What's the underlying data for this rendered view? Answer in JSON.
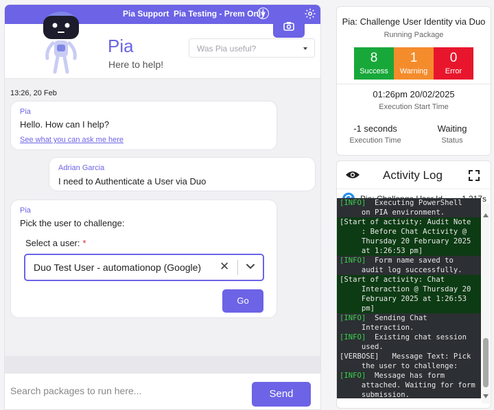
{
  "topbar": {
    "support_label": "Pia Support",
    "workspace_label": "Pia Testing - Prem Only",
    "info_glyph": "i"
  },
  "header": {
    "name": "Pia",
    "subtitle": "Here to help!",
    "feedback_placeholder": "Was Pia useful?"
  },
  "chat": {
    "timestamp": "13:26, 20 Feb",
    "messages": [
      {
        "sender": "Pia",
        "text": "Hello. How can I help?",
        "link": "See what you can ask me here"
      },
      {
        "sender": "Adrian Garcia",
        "text": "I need to Authenticate a User via Duo"
      },
      {
        "sender": "Pia",
        "text": "Pick the user to challenge:",
        "field_label": "Select a user:",
        "required_mark": "*",
        "selected_value": "Duo Test User - automationop (Google)",
        "clear_glyph": "✕",
        "submit_label": "Go"
      }
    ]
  },
  "search": {
    "placeholder": "Search packages to run here...",
    "send_label": "Send"
  },
  "status_card": {
    "title": "Pia: Challenge User Identity via Duo",
    "subtitle": "Running Package",
    "counts": [
      {
        "value": "8",
        "label": "Success",
        "color": "#18a83a"
      },
      {
        "value": "1",
        "label": "Warning",
        "color": "#f48c2c"
      },
      {
        "value": "0",
        "label": "Error",
        "color": "#e8162d"
      }
    ],
    "start_time": "01:26pm 20/02/2025",
    "start_label": "Execution Start Time",
    "exec_time": "-1 seconds",
    "exec_label": "Execution Time",
    "status": "Waiting",
    "status_label": "Status"
  },
  "activity_log": {
    "title": "Activity Log",
    "package": "Pia: Challenge User Identity via Duo",
    "duration": "-1.217s",
    "lines": [
      {
        "tag": "[INFO]",
        "text": "  Executing PowerShell",
        "style": "gray"
      },
      {
        "tag": "",
        "text": "     on PIA environment.",
        "style": "gray"
      },
      {
        "tag": "",
        "text": "[Start of activity: Audit Note",
        "style": "green"
      },
      {
        "tag": "",
        "text": "     : Before Chat Activity @",
        "style": "green"
      },
      {
        "tag": "",
        "text": "     Thursday 20 February 2025",
        "style": "green"
      },
      {
        "tag": "",
        "text": "     at 1:26:53 pm]",
        "style": "green"
      },
      {
        "tag": "[INFO]",
        "text": "  Form name saved to",
        "style": "gray"
      },
      {
        "tag": "",
        "text": "     audit log successfully.",
        "style": "gray"
      },
      {
        "tag": "",
        "text": "[Start of activity: Chat",
        "style": "green"
      },
      {
        "tag": "",
        "text": "     Interaction @ Thursday 20",
        "style": "green"
      },
      {
        "tag": "",
        "text": "     February 2025 at 1:26:53",
        "style": "green"
      },
      {
        "tag": "",
        "text": "     pm]",
        "style": "green"
      },
      {
        "tag": "[INFO]",
        "text": "  Sending Chat",
        "style": "gray"
      },
      {
        "tag": "",
        "text": "     Interaction.",
        "style": "gray"
      },
      {
        "tag": "[INFO]",
        "text": "  Existing chat session",
        "style": "gray"
      },
      {
        "tag": "",
        "text": "     used.",
        "style": "gray"
      },
      {
        "tag": "",
        "text": "[VERBOSE]   Message Text: Pick",
        "style": "gray"
      },
      {
        "tag": "",
        "text": "     the user to challenge:",
        "style": "gray"
      },
      {
        "tag": "[INFO]",
        "text": "  Message has form",
        "style": "gray"
      },
      {
        "tag": "",
        "text": "     attached. Waiting for form",
        "style": "gray"
      },
      {
        "tag": "",
        "text": "     submission.",
        "style": "gray"
      }
    ]
  }
}
